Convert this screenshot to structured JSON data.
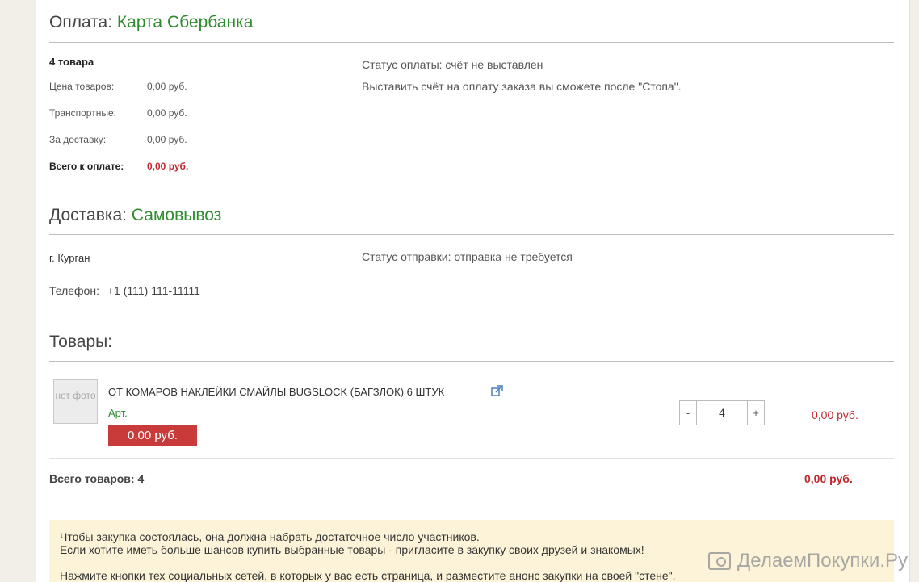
{
  "payment": {
    "title_prefix": "Оплата:",
    "title_value": "Карта Сбербанка",
    "count": "4 товара",
    "rows": [
      {
        "label": "Цена товаров:",
        "value": "0,00 руб."
      },
      {
        "label": "Транспортные:",
        "value": "0,00 руб."
      },
      {
        "label": "За доставку:",
        "value": "0,00 руб."
      }
    ],
    "total_label": "Всего к оплате:",
    "total_value": "0,00 руб.",
    "status": "Статус оплаты: счёт не выставлен",
    "status_note": "Выставить счёт на оплату заказа вы сможете после \"Стопа\"."
  },
  "delivery": {
    "title_prefix": "Доставка:",
    "title_value": "Самовывоз",
    "city": "г. Курган",
    "phone_label": "Телефон:",
    "phone_value": "+1 (111) 111-11111",
    "status": "Статус отправки: отправка не требуется"
  },
  "goods": {
    "title": "Товары:",
    "item": {
      "thumb_text": "нет фото",
      "name": "ОТ КОМАРОВ НАКЛЕЙКИ СМАЙЛЫ BUGSLOCK (БАГЗЛОК) 6 ШТУК",
      "art_label": "Арт.",
      "unit_price": "0,00 руб.",
      "qty_minus": "-",
      "qty": "4",
      "qty_plus": "+",
      "line_total": "0,00 руб.",
      "external_icon": "external-link-icon"
    },
    "total_label": "Всего товаров: 4",
    "total_value": "0,00 руб."
  },
  "notice": {
    "line1": "Чтобы закупка состоялась, она должна набрать достаточное число участников.",
    "line2": "Если хотите иметь больше шансов купить выбранные товары - пригласите в закупку своих друзей и знакомых!",
    "line3": "Нажмите кнопки тех социальных сетей, в которых у вас есть страница, и разместите анонс закупки на своей \"стене\"."
  },
  "watermark": "ДелаемПокупки.Ру",
  "colors": {
    "accent_green": "#2e8b2e",
    "price_red": "#c0282d",
    "badge_red": "#c93a3a",
    "notice_bg": "#fdf3d8"
  }
}
